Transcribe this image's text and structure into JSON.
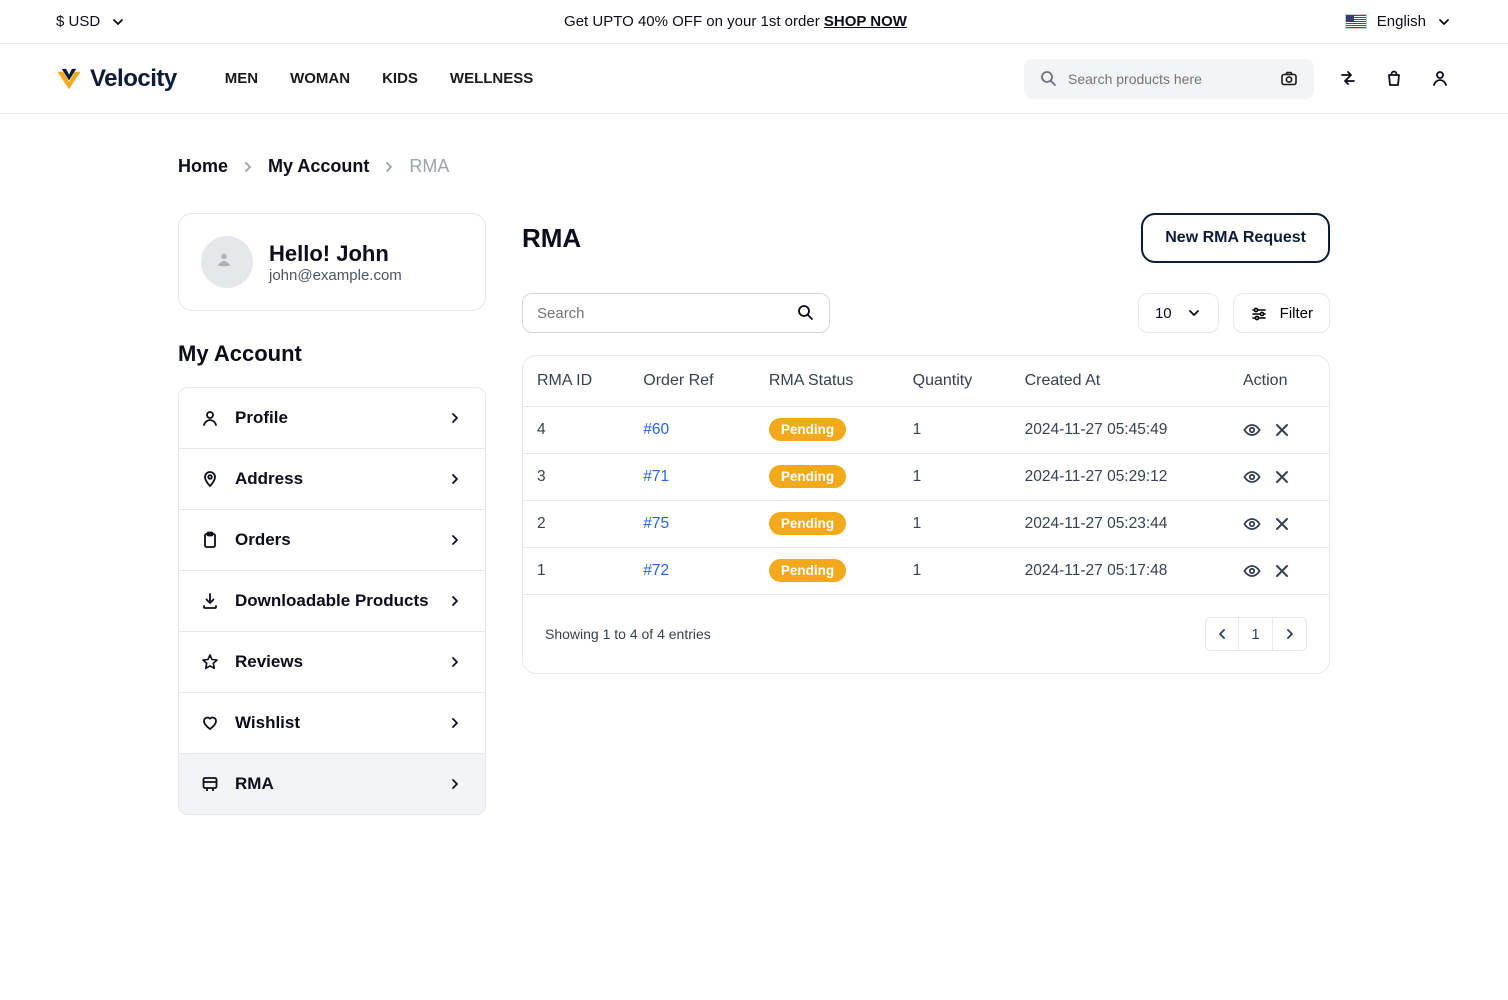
{
  "topbar": {
    "currency": "$ USD",
    "promo_prefix": "Get UPTO 40% OFF on your 1st order ",
    "promo_cta": "SHOP NOW",
    "language": "English"
  },
  "header": {
    "logo_text": "Velocity",
    "nav": {
      "men": "MEN",
      "woman": "WOMAN",
      "kids": "KIDS",
      "wellness": "WELLNESS"
    },
    "search_placeholder": "Search products here"
  },
  "breadcrumb": {
    "home": "Home",
    "account": "My Account",
    "current": "RMA"
  },
  "sidebar": {
    "greeting": "Hello! John",
    "email": "john@example.com",
    "section_title": "My Account",
    "items": [
      {
        "label": "Profile",
        "icon": "user",
        "active": false
      },
      {
        "label": "Address",
        "icon": "pin",
        "active": false
      },
      {
        "label": "Orders",
        "icon": "clipboard",
        "active": false
      },
      {
        "label": "Downloadable Products",
        "icon": "download",
        "active": false
      },
      {
        "label": "Reviews",
        "icon": "star",
        "active": false
      },
      {
        "label": "Wishlist",
        "icon": "heart",
        "active": false
      },
      {
        "label": "RMA",
        "icon": "rma",
        "active": true
      }
    ]
  },
  "panel": {
    "title": "RMA",
    "new_btn": "New RMA Request",
    "search_placeholder": "Search",
    "per_page": "10",
    "filter_label": "Filter",
    "columns": {
      "id": "RMA ID",
      "ref": "Order Ref",
      "status": "RMA Status",
      "qty": "Quantity",
      "created": "Created At",
      "action": "Action"
    },
    "rows": [
      {
        "id": "4",
        "ref": "#60",
        "status": "Pending",
        "qty": "1",
        "created": "2024-11-27 05:45:49"
      },
      {
        "id": "3",
        "ref": "#71",
        "status": "Pending",
        "qty": "1",
        "created": "2024-11-27 05:29:12"
      },
      {
        "id": "2",
        "ref": "#75",
        "status": "Pending",
        "qty": "1",
        "created": "2024-11-27 05:23:44"
      },
      {
        "id": "1",
        "ref": "#72",
        "status": "Pending",
        "qty": "1",
        "created": "2024-11-27 05:17:48"
      }
    ],
    "footer_text": "Showing 1 to 4 of 4 entries",
    "page": "1"
  }
}
